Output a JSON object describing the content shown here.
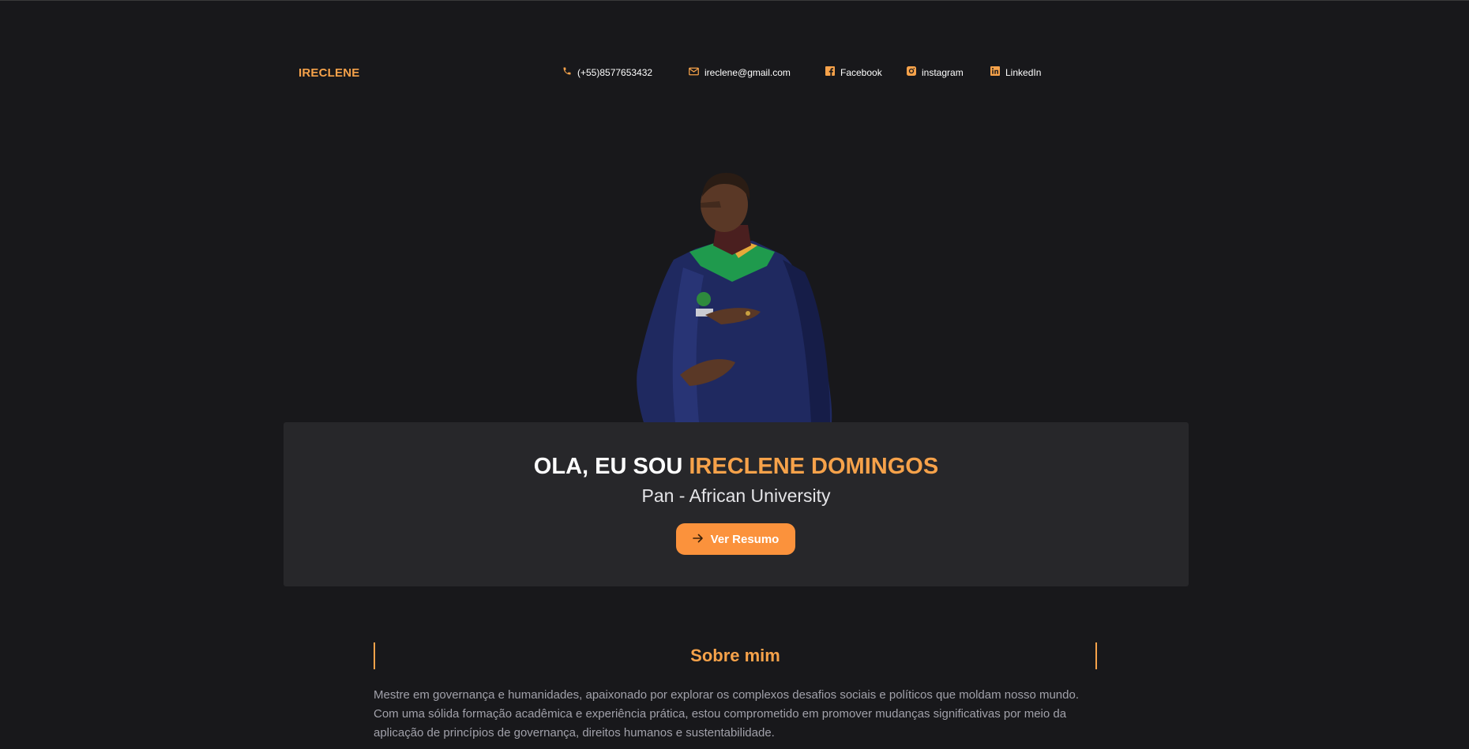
{
  "header": {
    "brand": "IRECLENE",
    "contacts": {
      "phone": {
        "label": "(+55)8577653432",
        "icon": "phone-icon"
      },
      "email": {
        "label": "ireclene@gmail.com",
        "icon": "mail-icon"
      },
      "facebook": {
        "label": "Facebook",
        "icon": "facebook-icon"
      },
      "instagram": {
        "label": "instagram",
        "icon": "instagram-icon"
      },
      "linkedin": {
        "label": "LinkedIn",
        "icon": "linkedin-icon"
      }
    }
  },
  "hero": {
    "greeting_prefix": "OLA, EU SOU ",
    "name": "IRECLENE DOMINGOS",
    "subtitle": "Pan - African University",
    "cta_label": "Ver Resumo",
    "cta_icon": "arrow-right-icon"
  },
  "about": {
    "title": "Sobre mim",
    "text": "Mestre em governança e humanidades, apaixonado por explorar os complexos desafios sociais e políticos que moldam nosso mundo. Com uma sólida formação acadêmica e experiência prática, estou comprometido em promover mudanças significativas por meio da aplicação de princípios de governança, direitos humanos e sustentabilidade."
  },
  "colors": {
    "background": "#18181b",
    "card": "#27272a",
    "accent": "#f6a24a",
    "button": "#fb923c"
  }
}
